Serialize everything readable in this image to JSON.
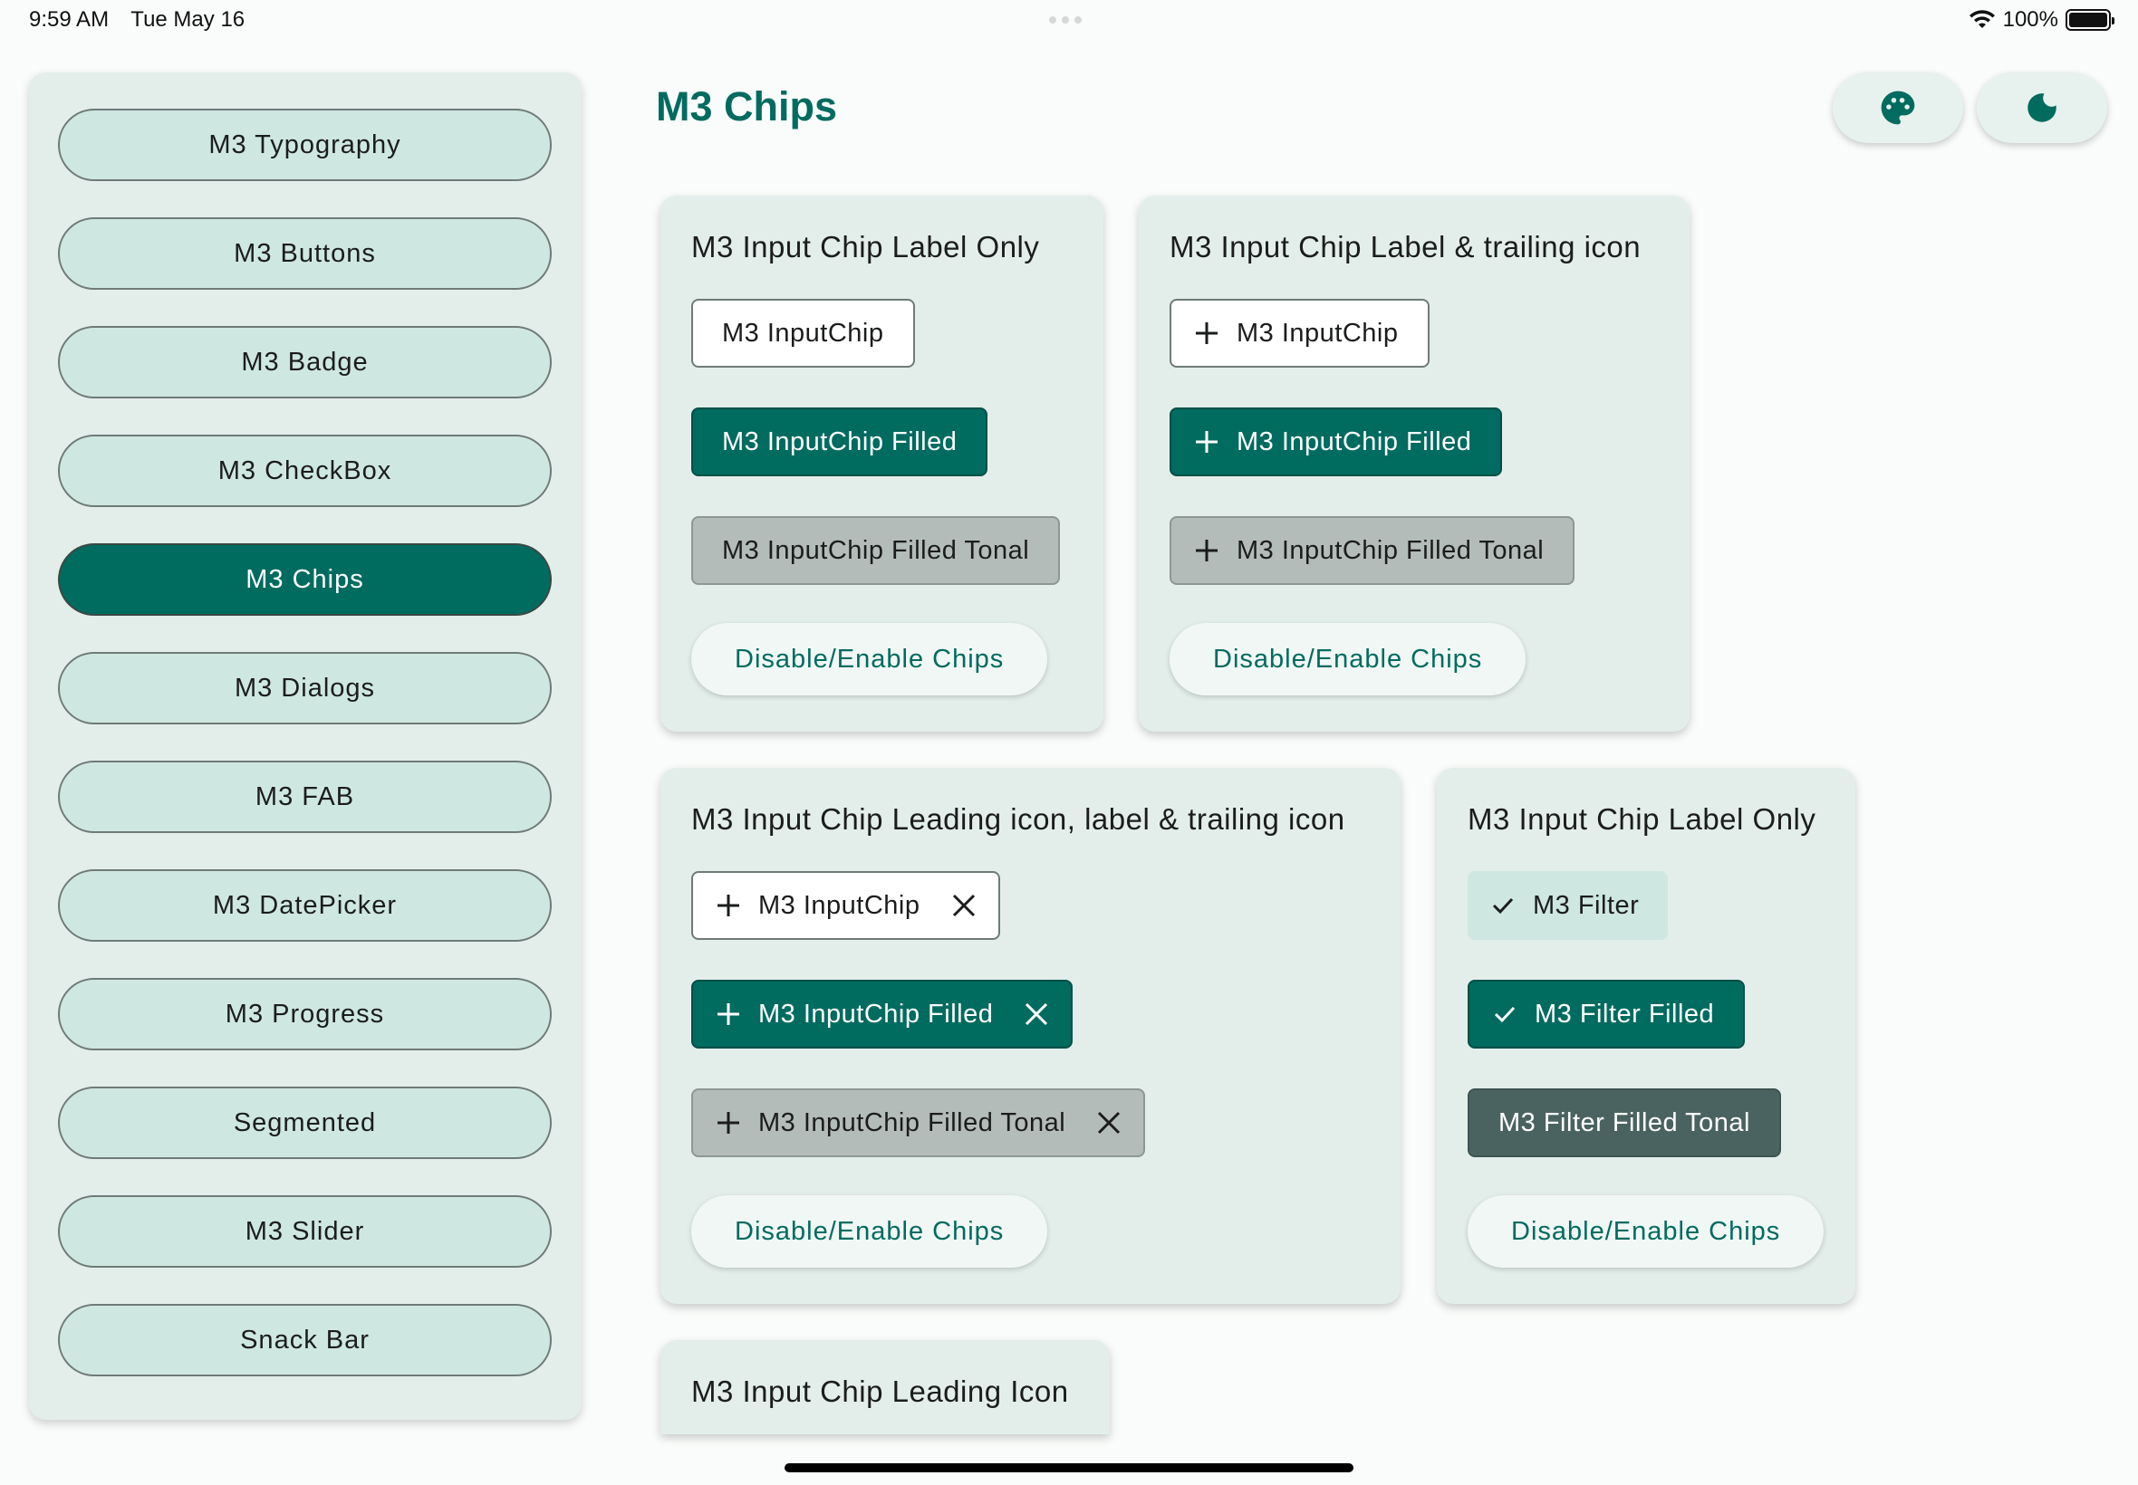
{
  "status_bar": {
    "time": "9:59 AM",
    "date": "Tue May 16",
    "battery": "100%"
  },
  "sidebar": {
    "items": [
      {
        "label": "M3 Typography",
        "active": false
      },
      {
        "label": "M3 Buttons",
        "active": false
      },
      {
        "label": "M3 Badge",
        "active": false
      },
      {
        "label": "M3 CheckBox",
        "active": false
      },
      {
        "label": "M3 Chips",
        "active": true
      },
      {
        "label": "M3 Dialogs",
        "active": false
      },
      {
        "label": "M3 FAB",
        "active": false
      },
      {
        "label": "M3 DatePicker",
        "active": false
      },
      {
        "label": "M3 Progress",
        "active": false
      },
      {
        "label": "Segmented",
        "active": false
      },
      {
        "label": "M3 Slider",
        "active": false
      },
      {
        "label": "Snack Bar",
        "active": false
      }
    ]
  },
  "header": {
    "title": "M3 Chips",
    "palette_icon": "palette-icon",
    "dark_mode_icon": "moon-icon"
  },
  "cards": {
    "label_only": {
      "title": "M3 Input Chip Label Only",
      "chips": [
        "M3 InputChip",
        "M3 InputChip Filled",
        "M3 InputChip Filled Tonal"
      ],
      "action": "Disable/Enable Chips"
    },
    "trailing": {
      "title": "M3 Input Chip Label & trailing icon",
      "chips": [
        "M3 InputChip",
        "M3 InputChip Filled",
        "M3 InputChip Filled Tonal"
      ],
      "action": "Disable/Enable Chips"
    },
    "leading_trailing": {
      "title": "M3 Input Chip Leading icon, label & trailing icon",
      "chips": [
        "M3 InputChip",
        "M3 InputChip Filled",
        "M3 InputChip Filled Tonal"
      ],
      "action": "Disable/Enable Chips"
    },
    "filter": {
      "title": "M3 Input Chip Label Only",
      "chips": [
        "M3 Filter",
        "M3 Filter Filled",
        "M3 Filter Filled Tonal"
      ],
      "action": "Disable/Enable Chips"
    },
    "leading": {
      "title": "M3 Input Chip Leading Icon"
    }
  },
  "colors": {
    "primary": "#006b5f",
    "surface": "#e3eeeb",
    "secondary_container": "#cfe7e1",
    "tonal": "#b4bcb9"
  }
}
